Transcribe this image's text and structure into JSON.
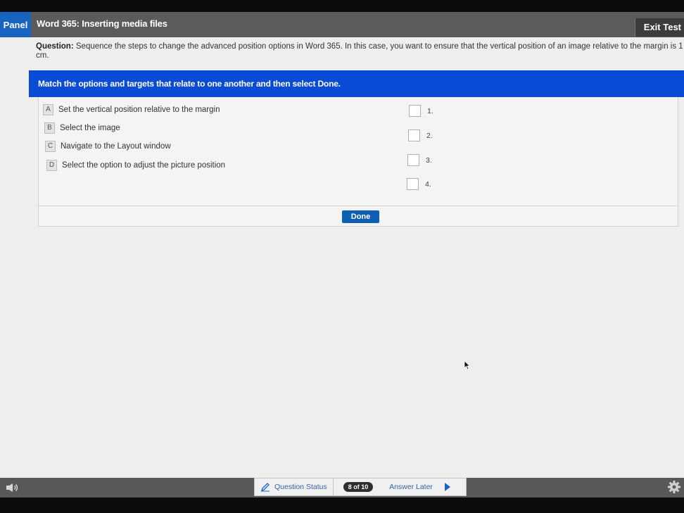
{
  "topbar": {
    "panel_label": "Panel",
    "title": "Word 365: Inserting media files",
    "exit_label": "Exit Test"
  },
  "question": {
    "prefix": "Question:",
    "text": "Sequence the steps to change the advanced position options in Word 365. In this case, you want to ensure that the vertical position of an image relative to the margin is 1 cm."
  },
  "instruction": {
    "text": "Match the options and targets that relate to one another and then select ",
    "emphasis": "Done."
  },
  "options": [
    {
      "letter": "A",
      "label": "Set the vertical position relative to the margin"
    },
    {
      "letter": "B",
      "label": "Select the image"
    },
    {
      "letter": "C",
      "label": "Navigate to the Layout window"
    },
    {
      "letter": "D",
      "label": "Select the option to adjust the picture position"
    }
  ],
  "targets": [
    {
      "label": "1."
    },
    {
      "label": "2."
    },
    {
      "label": "3."
    },
    {
      "label": "4."
    }
  ],
  "done_label": "Done",
  "bottombar": {
    "question_status": "Question Status",
    "counter": "8 of 10",
    "answer_later": "Answer Later"
  },
  "colors": {
    "accent_blue": "#0a4bd6",
    "panel_blue": "#1664c0",
    "done_blue": "#0f5fb6"
  },
  "icons": [
    "speaker-icon",
    "pencil-icon",
    "next-arrow-icon",
    "gear-icon"
  ]
}
